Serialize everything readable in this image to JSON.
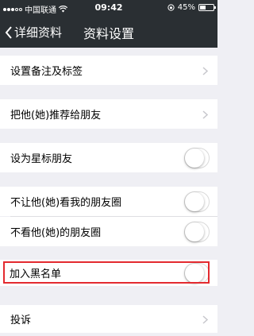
{
  "status_bar": {
    "carrier": "中国联通",
    "time": "09:42",
    "battery_percent": "45%",
    "battery_level": 0.45
  },
  "nav": {
    "back_label": "详细资料",
    "title": "资料设置"
  },
  "rows": {
    "remark": "设置备注及标签",
    "recommend": "把他(她)推荐给朋友",
    "star": "设为星标朋友",
    "hide_my_moments": "不让他(她)看我的朋友圈",
    "hide_their_moments": "不看他(她)的朋友圈",
    "blacklist": "加入黑名单",
    "report": "投诉"
  },
  "toggles": {
    "star": false,
    "hide_my_moments": false,
    "hide_their_moments": false,
    "blacklist": false
  },
  "colors": {
    "nav_bg": "#2a2f33",
    "highlight": "#e32a2f",
    "page_bg": "#efeff4"
  }
}
